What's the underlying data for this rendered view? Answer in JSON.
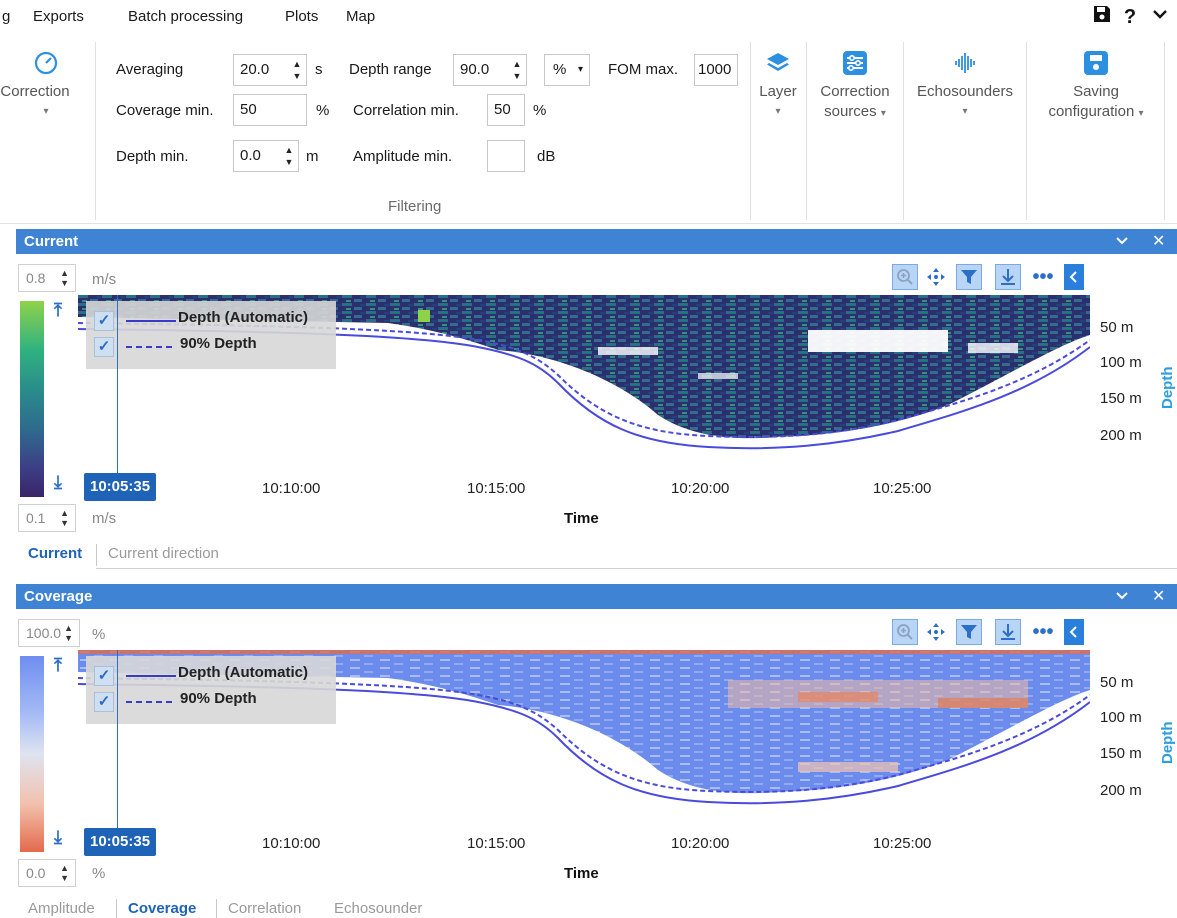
{
  "menu": {
    "items": [
      "g",
      "Exports",
      "Batch processing",
      "Plots",
      "Map"
    ],
    "right_icons": [
      "save-icon",
      "help-icon",
      "collapse-icon"
    ],
    "help_glyph": "?",
    "collapse_glyph": "⌄"
  },
  "ribbon": {
    "correction_label": "Correction",
    "averaging_label": "Averaging",
    "averaging_value": "20.0",
    "averaging_unit": "s",
    "depth_range_label": "Depth range",
    "depth_range_value": "90.0",
    "depth_range_unit": "%",
    "fom_label": "FOM max.",
    "fom_value": "1000",
    "coverage_min_label": "Coverage min.",
    "coverage_min_value": "50",
    "coverage_min_unit": "%",
    "correlation_min_label": "Correlation min.",
    "correlation_min_value": "50",
    "correlation_min_unit": "%",
    "depth_min_label": "Depth min.",
    "depth_min_value": "0.0",
    "depth_min_unit": "m",
    "amplitude_min_label": "Amplitude min.",
    "amplitude_min_value": "",
    "amplitude_min_unit": "dB",
    "group_title": "Filtering",
    "layer_label": "Layer",
    "correction_sources_line1": "Correction",
    "correction_sources_line2": "sources",
    "echosounders_label": "Echosounders",
    "saving_line1": "Saving",
    "saving_line2": "configuration",
    "colors": {
      "icon_blue": "#2c8fe0",
      "text_gray": "#6b6b6b"
    }
  },
  "current_panel": {
    "title": "Current",
    "scale_max": "0.8",
    "scale_min": "0.1",
    "unit": "m/s",
    "legend": [
      "Depth (Automatic)",
      "90% Depth"
    ],
    "depth_ticks": [
      "50 m",
      "100 m",
      "150 m",
      "200 m"
    ],
    "depth_axis_label": "Depth",
    "time_ticks": [
      "10:10:00",
      "10:15:00",
      "10:20:00",
      "10:25:00"
    ],
    "time_axis_label": "Time",
    "cursor_time": "10:05:35",
    "tabs": [
      "Current",
      "Current direction"
    ],
    "active_tab": "Current"
  },
  "coverage_panel": {
    "title": "Coverage",
    "scale_max": "100.0",
    "scale_min": "0.0",
    "unit": "%",
    "legend": [
      "Depth (Automatic)",
      "90% Depth"
    ],
    "depth_ticks": [
      "50 m",
      "100 m",
      "150 m",
      "200 m"
    ],
    "depth_axis_label": "Depth",
    "time_ticks": [
      "10:10:00",
      "10:15:00",
      "10:20:00",
      "10:25:00"
    ],
    "time_axis_label": "Time",
    "cursor_time": "10:05:35",
    "tabs": [
      "Amplitude",
      "Coverage",
      "Correlation",
      "Echosounder"
    ],
    "active_tab": "Coverage"
  },
  "toolbar": [
    "zoom-icon",
    "pan-icon",
    "filter-icon",
    "download-icon",
    "more-icon",
    "collapse-left-icon"
  ],
  "header_controls": {
    "collapse_glyph": "⌄",
    "close_glyph": "✕"
  }
}
